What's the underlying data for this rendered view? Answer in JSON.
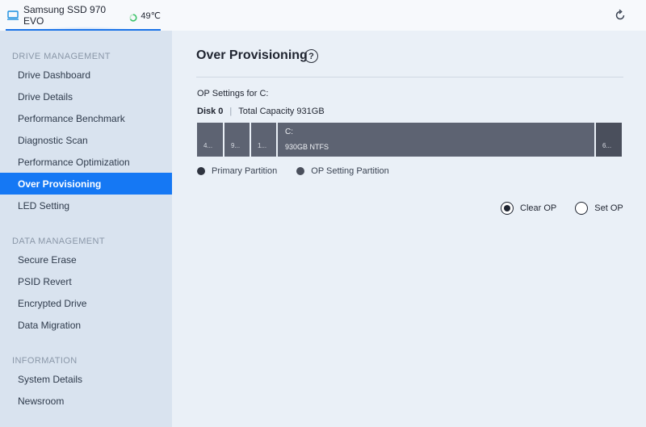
{
  "topbar": {
    "drive_name": "Samsung SSD 970 EVO",
    "temperature": "49℃",
    "refresh_icon": "refresh-icon",
    "drive_icon": "monitor-icon",
    "accent_color": "#1a73e8"
  },
  "sidebar": {
    "sections": [
      {
        "title": "DRIVE MANAGEMENT",
        "items": [
          "Drive Dashboard",
          "Drive Details",
          "Performance Benchmark",
          "Diagnostic Scan",
          "Performance Optimization",
          "Over Provisioning",
          "LED Setting"
        ]
      },
      {
        "title": "DATA MANAGEMENT",
        "items": [
          "Secure Erase",
          "PSID Revert",
          "Encrypted Drive",
          "Data Migration"
        ]
      },
      {
        "title": "INFORMATION",
        "items": [
          "System Details",
          "Newsroom"
        ]
      }
    ],
    "active_item": "Over Provisioning",
    "active_color": "#1578f4"
  },
  "main": {
    "title": "Over Provisioning",
    "help_icon": "?",
    "op_settings_label": "OP Settings for C:",
    "disk": "Disk 0",
    "total_capacity": "Total Capacity 931GB",
    "partitions": [
      {
        "label": "4..."
      },
      {
        "label": "9..."
      },
      {
        "label": "1..."
      },
      {
        "letter": "C:",
        "info": "930GB NTFS"
      },
      {
        "label": "6..."
      }
    ],
    "legend": [
      {
        "label": "Primary Partition",
        "color": "#2f3440"
      },
      {
        "label": "OP Setting Partition",
        "color": "#4a4f5c"
      }
    ],
    "options": [
      {
        "label": "Clear OP",
        "selected": true
      },
      {
        "label": "Set OP",
        "selected": false
      }
    ]
  }
}
